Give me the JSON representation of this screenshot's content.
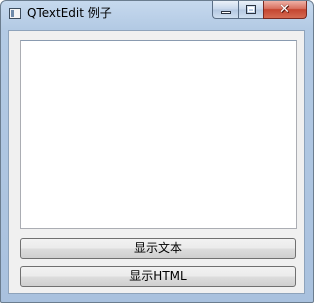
{
  "window": {
    "title": "QTextEdit 例子",
    "icon": "qt-window-icon"
  },
  "caption_buttons": {
    "minimize": "minimize-icon",
    "maximize": "maximize-icon",
    "close": "close-icon",
    "close_glyph": "✕"
  },
  "text_edit": {
    "value": ""
  },
  "buttons": {
    "show_text": "显示文本",
    "show_html": "显示HTML"
  },
  "colors": {
    "titlebar": "#b9cfe7",
    "close_button": "#c44530",
    "client_background": "#f0f0f0"
  }
}
